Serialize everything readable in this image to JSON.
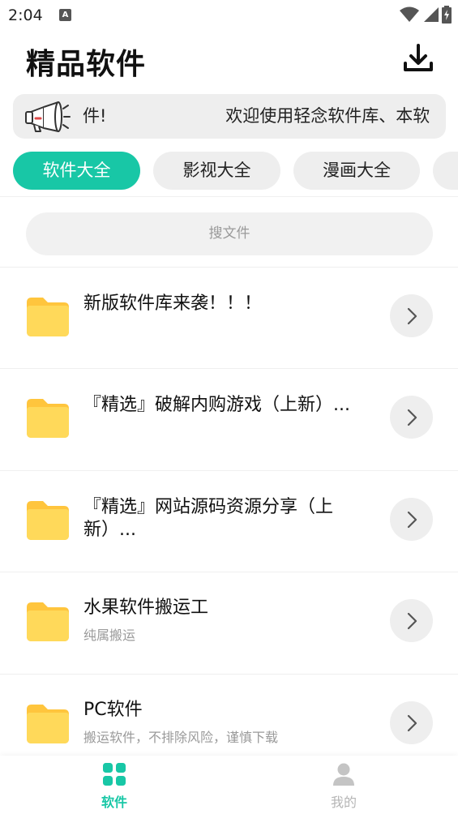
{
  "status": {
    "time": "2:04",
    "notif_letter": "A"
  },
  "header": {
    "title": "精品软件",
    "download_icon": "download-icon"
  },
  "notice": {
    "icon": "megaphone-icon",
    "text": "件!                      欢迎使用轻念软件库、本软"
  },
  "tabs": [
    {
      "label": "软件大全",
      "active": true
    },
    {
      "label": "影视大全",
      "active": false
    },
    {
      "label": "漫画大全",
      "active": false
    },
    {
      "label": "",
      "active": false
    }
  ],
  "search": {
    "placeholder": "搜文件"
  },
  "items": [
    {
      "title": "新版软件库来袭！！！",
      "subtitle": ""
    },
    {
      "title": "『精选』破解内购游戏（上新）...",
      "subtitle": ""
    },
    {
      "title": "『精选』网站源码资源分享（上新）...",
      "subtitle": ""
    },
    {
      "title": "水果软件搬运工",
      "subtitle": "纯属搬运"
    },
    {
      "title": "PC软件",
      "subtitle": "搬运软件，不排除风险，谨慎下载"
    }
  ],
  "bottom_nav": [
    {
      "label": "软件",
      "icon": "grid-icon",
      "active": true
    },
    {
      "label": "我的",
      "icon": "user-icon",
      "active": false
    }
  ],
  "colors": {
    "accent": "#18c7a6",
    "folder": "#ffd54f",
    "inactive": "#b5b5b5"
  }
}
